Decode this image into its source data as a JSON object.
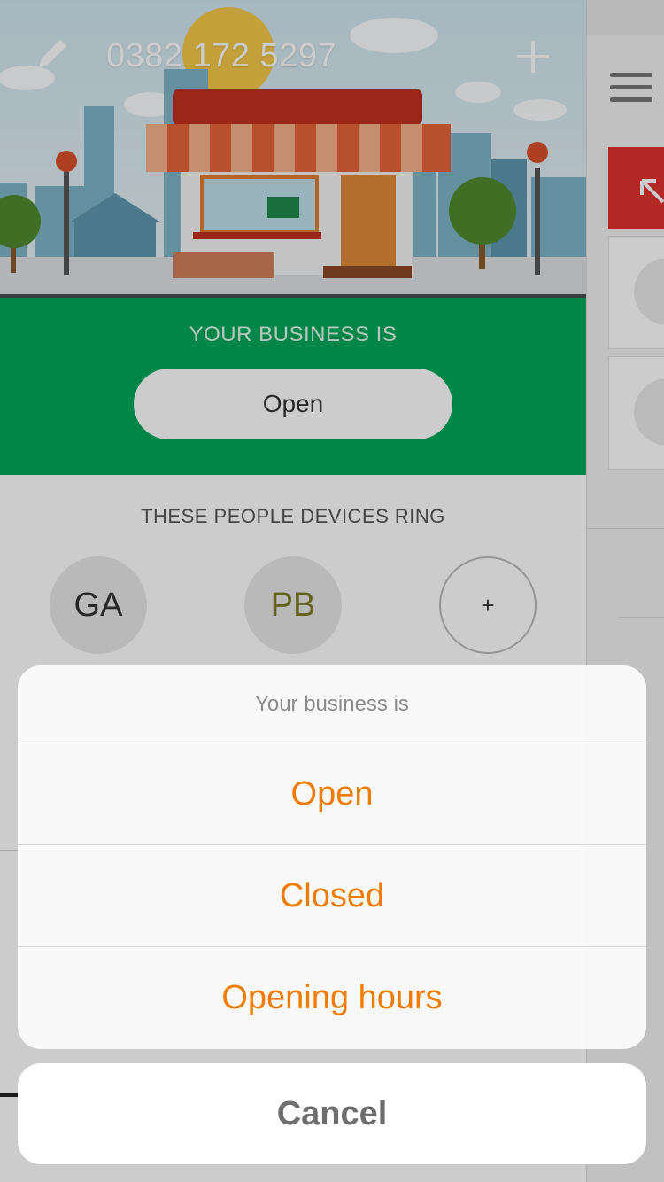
{
  "header": {
    "phone_number": "0382 172 5297",
    "edit_icon": "pencil-icon",
    "add_icon": "plus-icon"
  },
  "status_section": {
    "label": "YOUR BUSINESS IS",
    "current_status": "Open",
    "background_color": "#00a85a"
  },
  "people_section": {
    "label": "THESE PEOPLE DEVICES RING",
    "avatars": [
      {
        "initials": "GA"
      },
      {
        "initials": "PB"
      }
    ],
    "add_label": "+"
  },
  "action_sheet": {
    "title": "Your business is",
    "options": [
      "Open",
      "Closed",
      "Opening hours"
    ],
    "cancel_label": "Cancel",
    "accent_color": "#f07d00"
  },
  "side_panel": {
    "menu_icon": "hamburger-icon",
    "expand_icon": "expand-arrow-icon"
  }
}
